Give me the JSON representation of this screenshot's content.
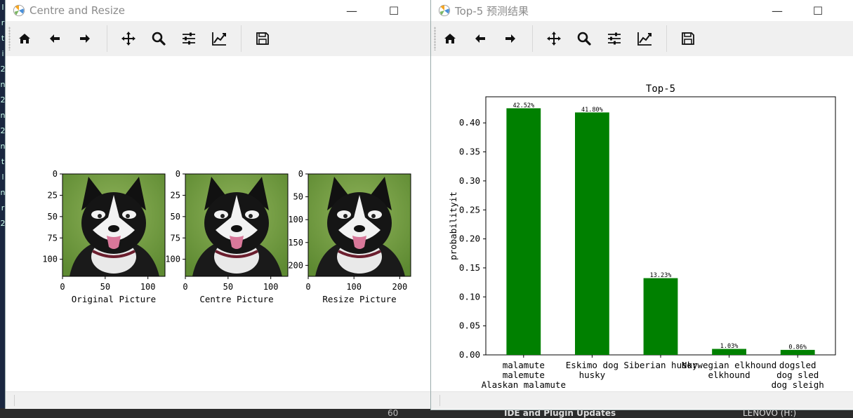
{
  "left_strip_glyphs": [
    "I",
    "r",
    "t",
    "i",
    "2",
    "n",
    "2",
    "n",
    "2",
    "n",
    "t",
    "l",
    "n",
    "r",
    "2"
  ],
  "taskbar": {
    "item1": "60",
    "item2": "IDE and Plugin Updates",
    "item3": "LENOVO (H:)"
  },
  "window1": {
    "title": "Centre and Resize",
    "controls": {
      "minimize": "—",
      "maximize": "☐"
    },
    "subplots": [
      {
        "xlabel": "Original Picture",
        "xticks": [
          "0",
          "50",
          "100"
        ],
        "yticks": [
          "0",
          "25",
          "50",
          "75",
          "100"
        ]
      },
      {
        "xlabel": "Centre Picture",
        "xticks": [
          "0",
          "50",
          "100"
        ],
        "yticks": [
          "0",
          "25",
          "50",
          "75",
          "100"
        ]
      },
      {
        "xlabel": "Resize Picture",
        "xticks": [
          "0",
          "100",
          "200"
        ],
        "yticks": [
          "0",
          "50",
          "100",
          "150",
          "200"
        ]
      }
    ]
  },
  "window2": {
    "title": "Top-5 预测结果",
    "controls": {
      "minimize": "—",
      "maximize": "☐"
    }
  },
  "toolbar_icons": [
    "home-icon",
    "back-arrow-icon",
    "forward-arrow-icon",
    "pan-icon",
    "zoom-icon",
    "configure-subplots-icon",
    "edit-axis-icon",
    "save-icon"
  ],
  "colors": {
    "bar": "#008000",
    "title_text": "#8b8b8b",
    "toolbar_bg": "#f0f0f0"
  },
  "chart_data": {
    "type": "bar",
    "title": "Top-5",
    "xlabel": "",
    "ylabel": "probabilityit",
    "ylim": [
      0,
      0.445
    ],
    "grid": false,
    "categories": [
      [
        "malamute",
        "malemute",
        "Alaskan malamute"
      ],
      [
        "Eskimo dog",
        "husky"
      ],
      [
        "Siberian husky"
      ],
      [
        "Norwegian elkhound",
        "elkhound"
      ],
      [
        "dogsled",
        "dog sled",
        "dog sleigh"
      ]
    ],
    "values": [
      0.4252,
      0.418,
      0.1323,
      0.0103,
      0.0086
    ],
    "data_labels": [
      "42.52%",
      "41.80%",
      "13.23%",
      "1.03%",
      "0.86%"
    ],
    "yticks": [
      "0.00",
      "0.05",
      "0.10",
      "0.15",
      "0.20",
      "0.25",
      "0.30",
      "0.35",
      "0.40"
    ],
    "yticks_values": [
      0,
      0.05,
      0.1,
      0.15,
      0.2,
      0.25,
      0.3,
      0.35,
      0.4
    ],
    "bar_color": "#008000"
  }
}
